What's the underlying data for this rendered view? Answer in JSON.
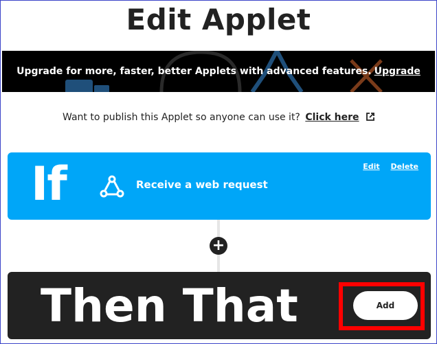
{
  "header": {
    "title": "Edit Applet"
  },
  "banner": {
    "message": "Upgrade for more, faster, better Applets with advanced features.",
    "link_label": "Upgrade"
  },
  "publish": {
    "prompt": "Want to publish this Applet so anyone can use it?",
    "link_label": "Click here",
    "link_icon": "external-link-icon"
  },
  "trigger": {
    "keyword": "If",
    "icon": "webhook-icon",
    "label": "Receive a web request",
    "edit_label": "Edit",
    "delete_label": "Delete",
    "color": "#00a6f8"
  },
  "connector": {
    "add_step_symbol": "+"
  },
  "action": {
    "keyword": "Then That",
    "add_label": "Add",
    "color": "#222222",
    "highlight_color": "#ff0000"
  }
}
